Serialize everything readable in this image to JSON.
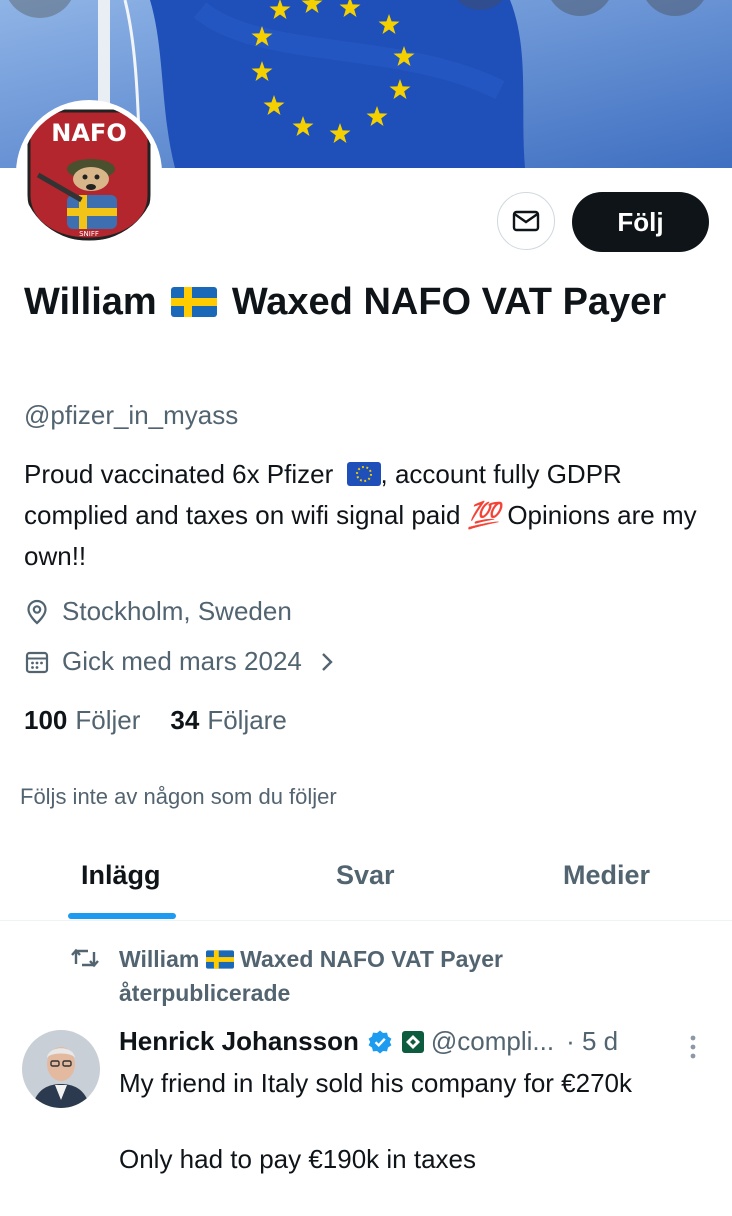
{
  "profile": {
    "avatar_text": "NAFO",
    "name_part1": "William",
    "name_part2": "Waxed NAFO VAT Payer",
    "handle": "@pfizer_in_myass",
    "bio_part1": "Proud vaccinated 6x Pfizer",
    "bio_part2": ", account fully GDPR complied and taxes on wifi signal paid",
    "bio_emoji": "💯",
    "bio_part3": "Opinions are my own!!",
    "location": "Stockholm, Sweden",
    "joined": "Gick med mars 2024",
    "following_count": "100",
    "following_label": "Följer",
    "followers_count": "34",
    "followers_label": "Följare",
    "not_followed_text": "Följs inte av någon som du följer"
  },
  "actions": {
    "follow_label": "Följ",
    "message_icon": "mail-icon"
  },
  "tabs": [
    {
      "label": "Inlägg",
      "active": true
    },
    {
      "label": "Svar",
      "active": false
    },
    {
      "label": "Medier",
      "active": false
    }
  ],
  "post": {
    "repost_by_part1": "William",
    "repost_by_part2": "Waxed NAFO VAT Payer",
    "repost_label": "återpublicerade",
    "author": "Henrick Johansson",
    "handle": "@compli...",
    "time": "· 5 d",
    "text_line1": "My friend in Italy sold his company for €270k",
    "text_line2": "Only had to pay €190k in taxes"
  },
  "colors": {
    "accent": "#1d9bf0",
    "follow_button": "#0f1419",
    "muted_text": "#536471"
  }
}
